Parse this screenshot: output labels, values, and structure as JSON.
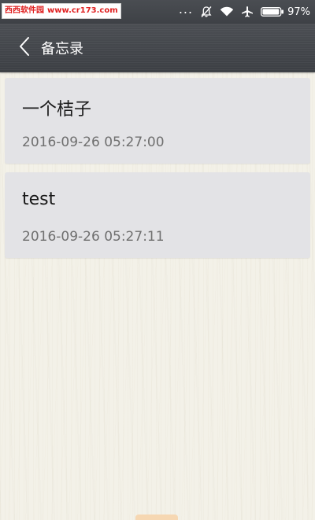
{
  "watermark": {
    "site_name": "西西软件园",
    "url": "www.cr173.com"
  },
  "status_bar": {
    "more_dots": "...",
    "battery_percent": "97%",
    "icons": [
      "notifications-off-icon",
      "wifi-icon",
      "airplane-mode-icon",
      "battery-icon"
    ],
    "battery_level": 0.97
  },
  "app_bar": {
    "title": "备忘录",
    "back_icon": "chevron-left-icon"
  },
  "notes": [
    {
      "title": "一个桔子",
      "time": "2016-09-26 05:27:00"
    },
    {
      "title": "test",
      "time": "2016-09-26 05:27:11"
    }
  ],
  "colors": {
    "app_bar": "#3e4146",
    "card": "#e3e3e6",
    "background": "#f3f1e8",
    "watermark_red": "#e02020"
  }
}
